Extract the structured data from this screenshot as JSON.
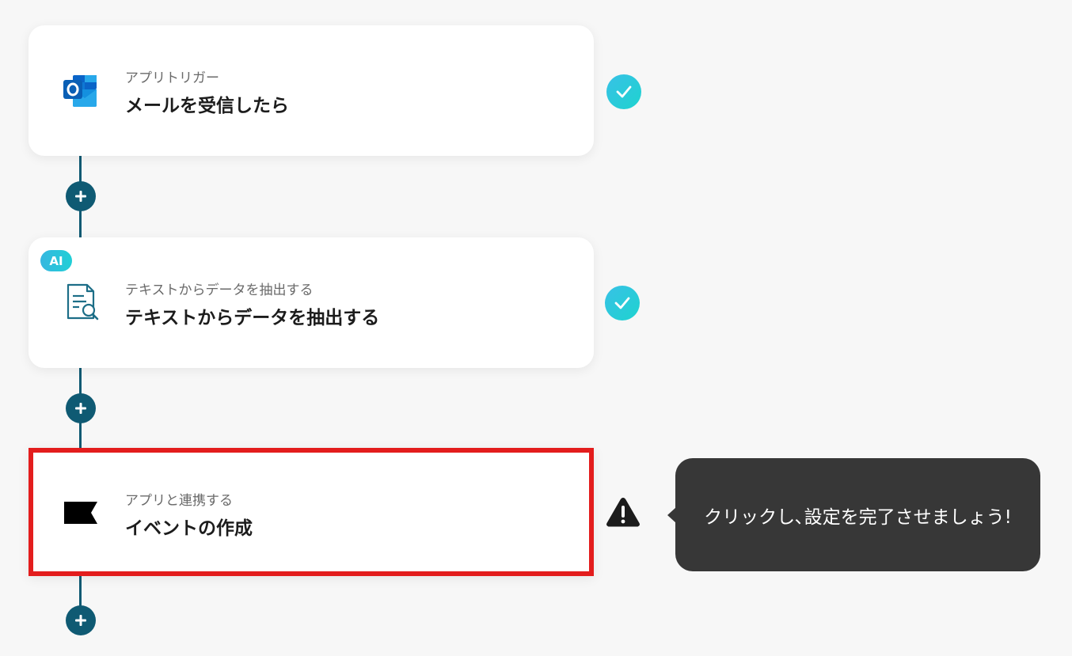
{
  "steps": [
    {
      "subtitle": "アプリトリガー",
      "title": "メールを受信したら",
      "icon": "outlook-icon",
      "status": "complete"
    },
    {
      "badge": "AI",
      "subtitle": "テキストからデータを抽出する",
      "title": "テキストからデータを抽出する",
      "icon": "document-search-icon",
      "status": "complete"
    },
    {
      "subtitle": "アプリと連携する",
      "title": "イベントの作成",
      "icon": "flag-icon",
      "status": "warning"
    }
  ],
  "tooltip": {
    "text": "クリックし､設定を完了させましょう!"
  },
  "colors": {
    "connector": "#0f5a73",
    "highlight_border": "#e31d1d",
    "check_gradient_start": "#38c1e6",
    "check_gradient_end": "#1ed3cf",
    "tooltip_bg": "#373737"
  }
}
